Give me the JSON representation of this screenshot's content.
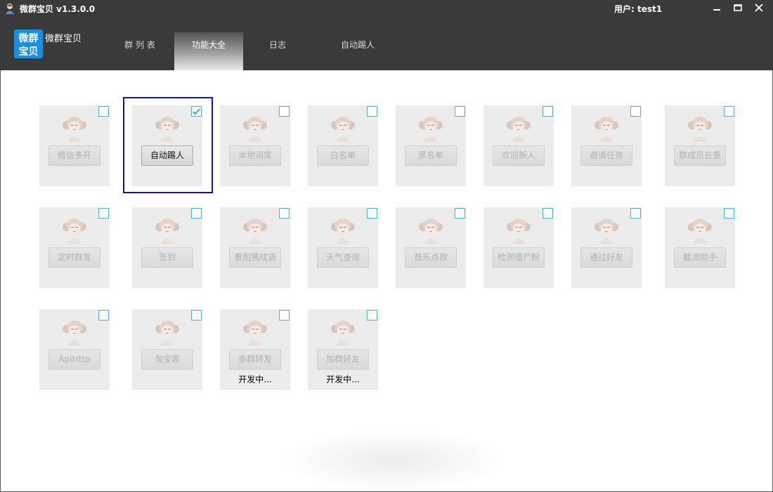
{
  "window": {
    "title": "微群宝贝 v1.3.0.0",
    "user_label": "用户: test1",
    "icons": {
      "app": "app-avatar-icon",
      "minimize": "minimize-icon",
      "maximize": "maximize-icon",
      "close": "close-icon"
    }
  },
  "brand": {
    "logo_text_line1": "微群",
    "logo_text_line2": "宝贝",
    "name": "微群宝贝",
    "logo_color": "#1a8fe0"
  },
  "tabs": [
    {
      "label": "群 列 表",
      "active": false
    },
    {
      "label": "功能大全",
      "active": true
    },
    {
      "label": "日志",
      "active": false
    },
    {
      "label": "自动踢人",
      "active": false
    }
  ],
  "features": [
    {
      "label": "微信多开",
      "checked": false,
      "active": false,
      "note": ""
    },
    {
      "label": "自动踢人",
      "checked": true,
      "active": true,
      "note": ""
    },
    {
      "label": "本地词库",
      "checked": false,
      "active": false,
      "note": ""
    },
    {
      "label": "白名单",
      "checked": false,
      "active": false,
      "note": ""
    },
    {
      "label": "黑名单",
      "checked": false,
      "active": false,
      "note": ""
    },
    {
      "label": "欢迎新人",
      "checked": false,
      "active": false,
      "note": ""
    },
    {
      "label": "邀请任务",
      "checked": false,
      "active": false,
      "note": ""
    },
    {
      "label": "群成员去重",
      "checked": false,
      "active": false,
      "note": ""
    },
    {
      "label": "定时群发",
      "checked": false,
      "active": false,
      "note": ""
    },
    {
      "label": "签到",
      "checked": false,
      "active": false,
      "note": ""
    },
    {
      "label": "看图猜成语",
      "checked": false,
      "active": false,
      "note": ""
    },
    {
      "label": "天气查询",
      "checked": false,
      "active": false,
      "note": ""
    },
    {
      "label": "音乐点歌",
      "checked": false,
      "active": false,
      "note": ""
    },
    {
      "label": "检测僵尸粉",
      "checked": false,
      "active": false,
      "note": ""
    },
    {
      "label": "通过好友",
      "checked": false,
      "active": false,
      "note": ""
    },
    {
      "label": "截流助手",
      "checked": false,
      "active": false,
      "note": ""
    },
    {
      "label": "ApiHttp",
      "checked": false,
      "active": false,
      "note": ""
    },
    {
      "label": "淘宝客",
      "checked": false,
      "active": false,
      "note": ""
    },
    {
      "label": "多群转发",
      "checked": false,
      "active": false,
      "note": "开发中..."
    },
    {
      "label": "加群好友",
      "checked": false,
      "active": false,
      "note": "开发中..."
    }
  ],
  "colors": {
    "header_bg": "#3a3a3a",
    "card_bg": "#ececec",
    "checkbox_border": "#4fb3e0",
    "selection_frame": "#1010d0"
  }
}
